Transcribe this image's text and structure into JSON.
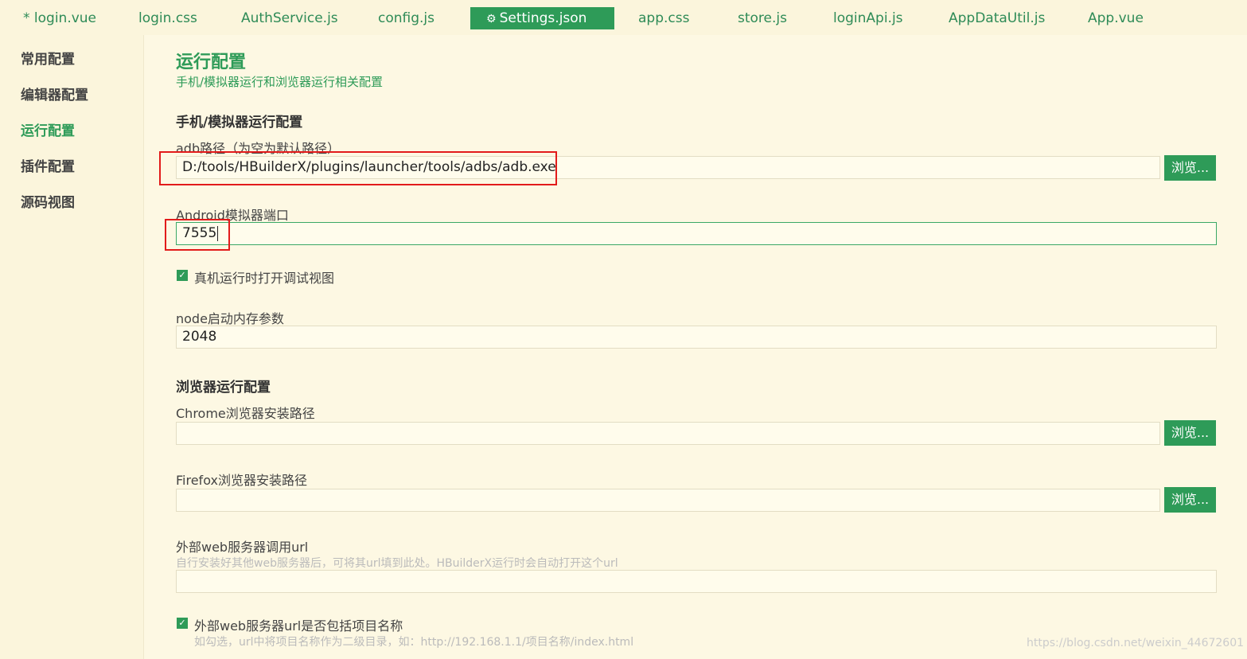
{
  "tabs": [
    {
      "label": "* login.vue",
      "active": false
    },
    {
      "label": "login.css",
      "active": false
    },
    {
      "label": "AuthService.js",
      "active": false
    },
    {
      "label": "config.js",
      "active": false
    },
    {
      "label": "Settings.json",
      "active": true,
      "icon": "gear-icon"
    },
    {
      "label": "app.css",
      "active": false
    },
    {
      "label": "store.js",
      "active": false
    },
    {
      "label": "loginApi.js",
      "active": false
    },
    {
      "label": "AppDataUtil.js",
      "active": false
    },
    {
      "label": "App.vue",
      "active": false
    }
  ],
  "sidebar": {
    "items": [
      {
        "label": "常用配置",
        "active": false
      },
      {
        "label": "编辑器配置",
        "active": false
      },
      {
        "label": "运行配置",
        "active": true
      },
      {
        "label": "插件配置",
        "active": false
      },
      {
        "label": "源码视图",
        "active": false
      }
    ]
  },
  "main": {
    "title": "运行配置",
    "subtitle": "手机/模拟器运行和浏览器运行相关配置",
    "phone_section": {
      "heading": "手机/模拟器运行配置",
      "adb_label": "adb路径（为空为默认路径）",
      "adb_value": "D:/tools/HBuilderX/plugins/launcher/tools/adbs/adb.exe",
      "browse_label": "浏览...",
      "port_label": "Android模拟器端口",
      "port_value": "7555",
      "debug_checkbox_label": "真机运行时打开调试视图",
      "debug_checked": true,
      "node_label": "node启动内存参数",
      "node_value": "2048"
    },
    "browser_section": {
      "heading": "浏览器运行配置",
      "chrome_label": "Chrome浏览器安装路径",
      "chrome_value": "",
      "firefox_label": "Firefox浏览器安装路径",
      "firefox_value": "",
      "browse_label": "浏览...",
      "web_url_label": "外部web服务器调用url",
      "web_url_hint": "自行安装好其他web服务器后，可将其url填到此处。HBuilderX运行时会自动打开这个url",
      "web_url_value": "",
      "include_name_label": "外部web服务器url是否包括项目名称",
      "include_name_checked": true,
      "include_name_hint": "如勾选，url中将项目名称作为二级目录，如：http://192.168.1.1/项目名称/index.html"
    }
  },
  "watermark": "https://blog.csdn.net/weixin_44672601",
  "colors": {
    "accent": "#2e9b58",
    "background": "#fdf8e3",
    "highlight_box": "#e21b1b"
  }
}
